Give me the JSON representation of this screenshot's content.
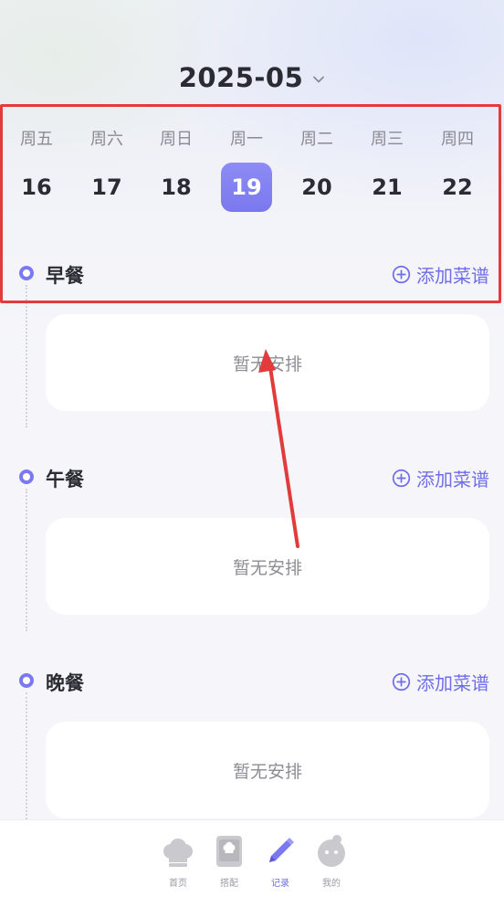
{
  "header": {
    "month": "2025-05"
  },
  "week": [
    {
      "weekday": "周五",
      "date": "16",
      "selected": false
    },
    {
      "weekday": "周六",
      "date": "17",
      "selected": false
    },
    {
      "weekday": "周日",
      "date": "18",
      "selected": false
    },
    {
      "weekday": "周一",
      "date": "19",
      "selected": true
    },
    {
      "weekday": "周二",
      "date": "20",
      "selected": false
    },
    {
      "weekday": "周三",
      "date": "21",
      "selected": false
    },
    {
      "weekday": "周四",
      "date": "22",
      "selected": false
    }
  ],
  "meals": [
    {
      "title": "早餐",
      "add_label": "添加菜谱",
      "empty_text": "暂无安排"
    },
    {
      "title": "午餐",
      "add_label": "添加菜谱",
      "empty_text": "暂无安排"
    },
    {
      "title": "晚餐",
      "add_label": "添加菜谱",
      "empty_text": "暂无安排"
    }
  ],
  "nav": [
    {
      "label": "首页",
      "icon": "chef-hat-icon",
      "active": false
    },
    {
      "label": "搭配",
      "icon": "recipe-book-icon",
      "active": false
    },
    {
      "label": "记录",
      "icon": "pencil-icon",
      "active": true
    },
    {
      "label": "我的",
      "icon": "profile-face-icon",
      "active": false
    }
  ],
  "colors": {
    "accent": "#7b79ef",
    "annotation": "#e23b3b",
    "text": "#2b2b33",
    "muted": "#8c8c93"
  }
}
